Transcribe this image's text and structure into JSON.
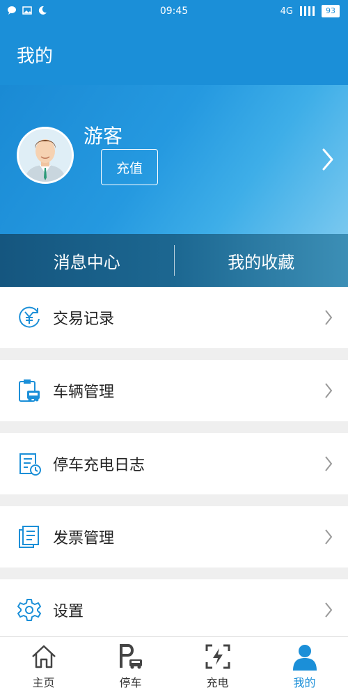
{
  "status_bar": {
    "time": "09:45",
    "network": "4G",
    "battery": "93"
  },
  "header": {
    "title": "我的"
  },
  "profile": {
    "name": "游客",
    "recharge_label": "充值"
  },
  "quick_actions": [
    {
      "label": "消息中心"
    },
    {
      "label": "我的收藏"
    }
  ],
  "menu": [
    {
      "label": "交易记录",
      "icon": "yuan-circle-icon"
    },
    {
      "label": "车辆管理",
      "icon": "vehicle-clipboard-icon"
    },
    {
      "label": "停车充电日志",
      "icon": "log-clock-icon"
    },
    {
      "label": "发票管理",
      "icon": "invoice-icon"
    },
    {
      "label": "设置",
      "icon": "gear-icon"
    }
  ],
  "bottom_nav": [
    {
      "label": "主页",
      "icon": "home-icon"
    },
    {
      "label": "停车",
      "icon": "parking-icon"
    },
    {
      "label": "充电",
      "icon": "charging-icon"
    },
    {
      "label": "我的",
      "icon": "person-icon",
      "active": true
    }
  ],
  "colors": {
    "primary": "#1b8fd8",
    "background": "#efefef",
    "text": "#222222"
  }
}
